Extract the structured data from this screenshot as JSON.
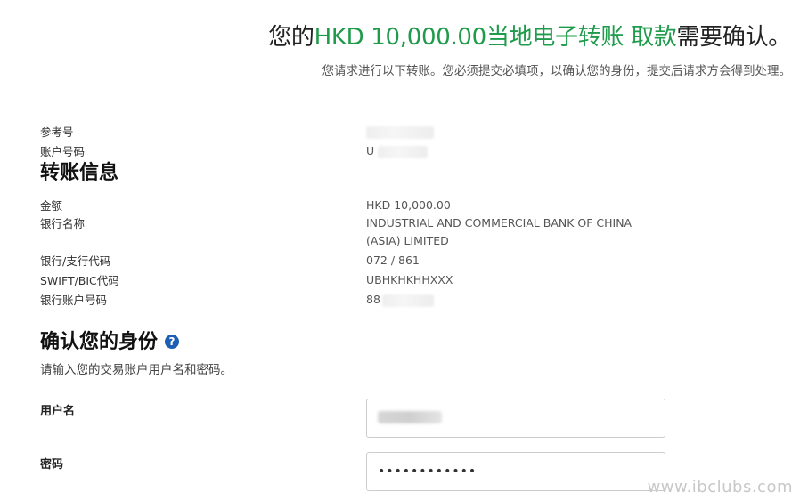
{
  "header": {
    "title_prefix": "您的",
    "title_highlight": "HKD 10,000.00当地电子转账 取款",
    "title_suffix": "需要确认。",
    "subtitle": "您请求进行以下转账。您必须提交必填项，以确认您的身份，提交后请求方会得到处理。"
  },
  "account": {
    "reference_label": "参考号",
    "reference_value": "",
    "account_label": "账户号码",
    "account_value": "U"
  },
  "transfer": {
    "section_title": "转账信息",
    "amount_label": "金额",
    "amount_value": "HKD 10,000.00",
    "bank_name_label": "银行名称",
    "bank_name_line1": "INDUSTRIAL AND COMMERCIAL BANK OF CHINA",
    "bank_name_line2": "(ASIA) LIMITED",
    "branch_code_label": "银行/支行代码",
    "branch_code_value": "072 / 861",
    "swift_label": "SWIFT/BIC代码",
    "swift_value": "UBHKHKHHXXX",
    "bank_account_label": "银行账户号码",
    "bank_account_value": "88"
  },
  "identity": {
    "section_title": "确认您的身份",
    "help_icon": "?",
    "instruction": "请输入您的交易账户用户名和密码。",
    "username_label": "用户名",
    "username_value": "",
    "password_label": "密码",
    "password_value": "••••••••••••"
  },
  "watermark": "www.ibclubs.com",
  "colors": {
    "accent_green": "#1f9b4b",
    "help_blue": "#1d5fb4"
  }
}
